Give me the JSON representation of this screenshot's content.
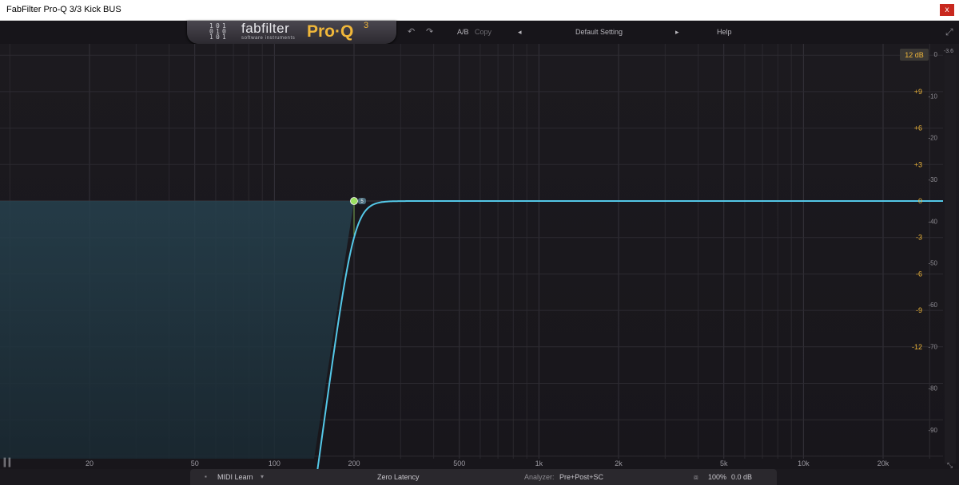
{
  "window": {
    "title": "FabFilter Pro-Q 3/3 Kick BUS",
    "close_label": "x"
  },
  "header": {
    "brand_name": "fabfilter",
    "brand_sub": "software instruments",
    "product": "Pro·Q",
    "product_version": "3",
    "ab_label": "A/B",
    "copy_label": "Copy",
    "preset_prev": "◂",
    "preset_name": "Default Setting",
    "preset_next": "▸",
    "help_label": "Help",
    "undo_icon": "undo-icon",
    "redo_icon": "redo-icon",
    "fullscreen_icon": "fullscreen-icon"
  },
  "graph": {
    "range_button": "12 dB",
    "meter_peak": "-3.6",
    "eq_gain_labels": [
      {
        "text": "+9",
        "db": 9
      },
      {
        "text": "+6",
        "db": 6
      },
      {
        "text": "+3",
        "db": 3
      },
      {
        "text": "0",
        "db": 0
      },
      {
        "text": "-3",
        "db": -3
      },
      {
        "text": "-6",
        "db": -6
      },
      {
        "text": "-9",
        "db": -9
      },
      {
        "text": "-12",
        "db": -12
      }
    ],
    "spectrum_labels": [
      {
        "text": "0",
        "db": 0
      },
      {
        "text": "-10",
        "db": -10
      },
      {
        "text": "-20",
        "db": -20
      },
      {
        "text": "-30",
        "db": -30
      },
      {
        "text": "-40",
        "db": -40
      },
      {
        "text": "-50",
        "db": -50
      },
      {
        "text": "-60",
        "db": -60
      },
      {
        "text": "-70",
        "db": -70
      },
      {
        "text": "-80",
        "db": -80
      },
      {
        "text": "-90",
        "db": -90
      }
    ],
    "freq_labels": [
      {
        "text": "20",
        "hz": 20
      },
      {
        "text": "50",
        "hz": 50
      },
      {
        "text": "100",
        "hz": 100
      },
      {
        "text": "200",
        "hz": 200
      },
      {
        "text": "500",
        "hz": 500
      },
      {
        "text": "1k",
        "hz": 1000
      },
      {
        "text": "2k",
        "hz": 2000
      },
      {
        "text": "5k",
        "hz": 5000
      },
      {
        "text": "10k",
        "hz": 10000
      },
      {
        "text": "20k",
        "hz": 20000
      }
    ],
    "band": {
      "number": "5",
      "type": "low-cut",
      "frequency_hz": 200,
      "gain_db": 0,
      "color": "#9be060",
      "curve_color": "#54c8e8"
    },
    "piano_icon": "piano-icon",
    "resize_icon": "resize-icon"
  },
  "bottom": {
    "midi_learn": "MIDI Learn",
    "latency": "Zero Latency",
    "analyzer_label": "Analyzer:",
    "analyzer_value": "Pre+Post+SC",
    "zoom": "100%",
    "output_gain": "0.0 dB"
  }
}
